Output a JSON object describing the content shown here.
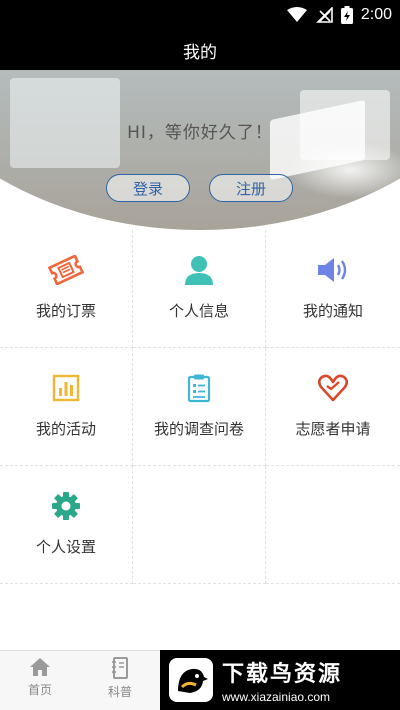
{
  "status_bar": {
    "time": "2:00"
  },
  "header": {
    "title": "我的"
  },
  "hero": {
    "greeting": "HI，等你好久了！",
    "login_label": "登录",
    "register_label": "注册"
  },
  "menu": {
    "items": [
      {
        "label": "我的订票",
        "icon": "ticket-icon",
        "color": "#f0673c"
      },
      {
        "label": "个人信息",
        "icon": "person-icon",
        "color": "#3fc1b8"
      },
      {
        "label": "我的通知",
        "icon": "speaker-icon",
        "color": "#6d83e6"
      },
      {
        "label": "我的活动",
        "icon": "bar-chart-icon",
        "color": "#f2b632"
      },
      {
        "label": "我的调查问卷",
        "icon": "clipboard-icon",
        "color": "#3eb6d6"
      },
      {
        "label": "志愿者申请",
        "icon": "heart-icon",
        "color": "#d9482b"
      },
      {
        "label": "个人设置",
        "icon": "gear-icon",
        "color": "#2aa889"
      }
    ]
  },
  "bottom_nav": {
    "items": [
      {
        "label": "首页",
        "icon": "home-icon"
      },
      {
        "label": "科普",
        "icon": "book-icon"
      }
    ]
  },
  "watermark": {
    "title": "下载鸟资源",
    "url": "www.xiazainiao.com"
  }
}
